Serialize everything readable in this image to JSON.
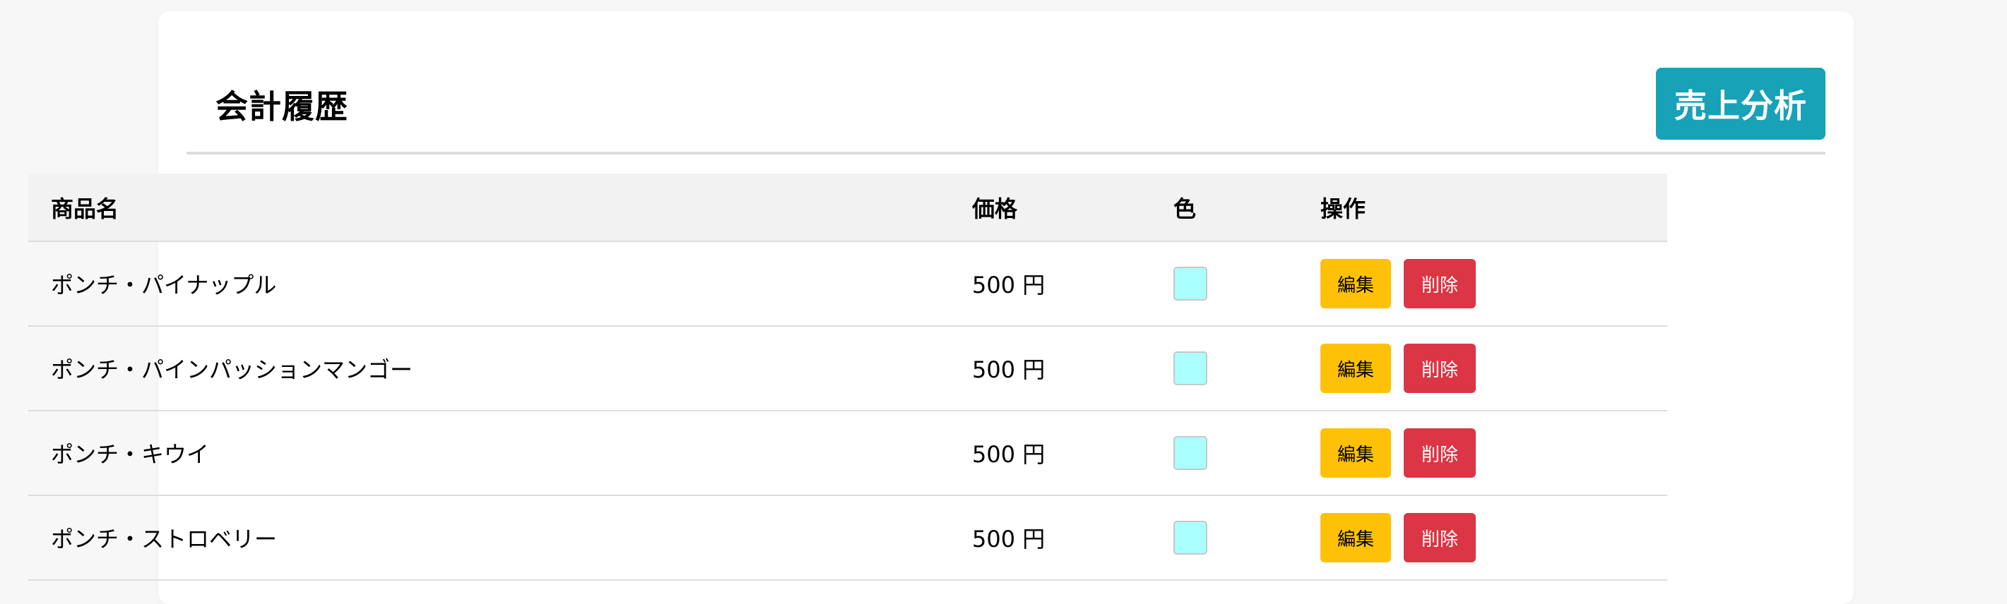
{
  "header": {
    "title": "会計履歴",
    "analysis_button": "売上分析"
  },
  "table": {
    "columns": [
      "商品名",
      "価格",
      "色",
      "操作"
    ],
    "rows": [
      {
        "name": "ポンチ・パイナップル",
        "price": "500 円",
        "color": "#aaffff",
        "edit": "編集",
        "delete": "削除"
      },
      {
        "name": "ポンチ・パインパッションマンゴー",
        "price": "500 円",
        "color": "#aaffff",
        "edit": "編集",
        "delete": "削除"
      },
      {
        "name": "ポンチ・キウイ",
        "price": "500 円",
        "color": "#aaffff",
        "edit": "編集",
        "delete": "削除"
      },
      {
        "name": "ポンチ・ストロベリー",
        "price": "500 円",
        "color": "#aaffff",
        "edit": "編集",
        "delete": "削除"
      }
    ]
  },
  "colors": {
    "accent": "#17a2b8",
    "edit": "#ffc107",
    "delete": "#dc3545"
  }
}
